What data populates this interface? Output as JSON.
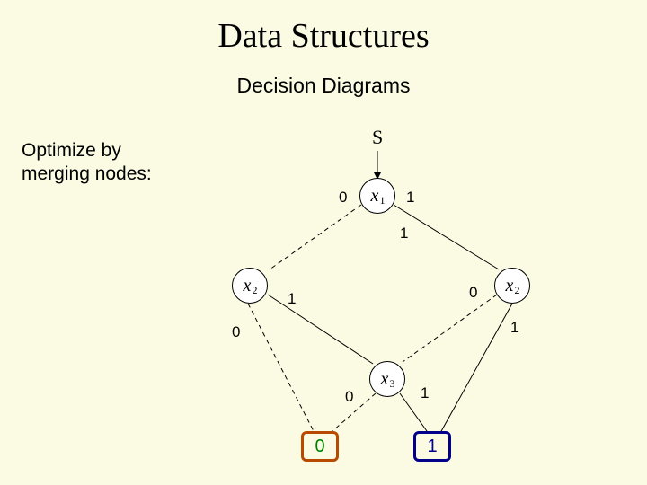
{
  "title": "Data Structures",
  "subtitle": "Decision Diagrams",
  "sidenote_line1": "Optimize by",
  "sidenote_line2": "merging nodes:",
  "root_label": "S",
  "nodes": {
    "x1": {
      "var": "x",
      "sub": "1"
    },
    "x2L": {
      "var": "x",
      "sub": "2"
    },
    "x2R": {
      "var": "x",
      "sub": "2"
    },
    "x3": {
      "var": "x",
      "sub": "3"
    }
  },
  "leaves": {
    "zero": "0",
    "one": "1"
  },
  "edge_labels": {
    "x1_left": "0",
    "x1_right": "1",
    "x1_right2": "1",
    "x2L_right": "1",
    "x2L_down": "0",
    "x2R_left": "0",
    "x2R_down": "1",
    "x3_left": "0",
    "x3_right": "1"
  }
}
